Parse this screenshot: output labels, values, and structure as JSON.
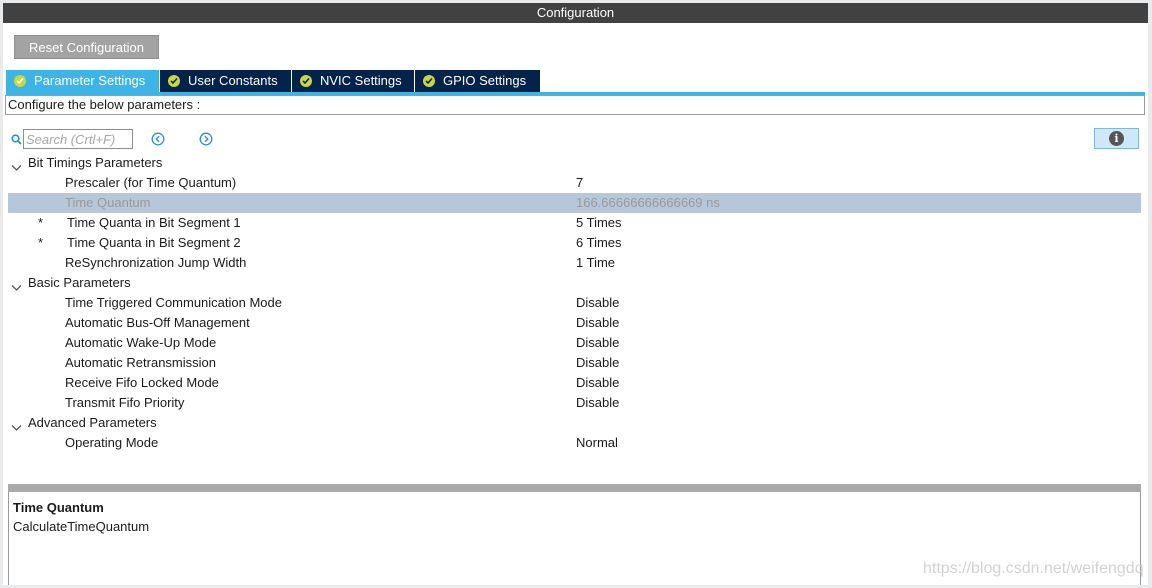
{
  "window": {
    "title": "Configuration"
  },
  "toolbar": {
    "reset_label": "Reset Configuration"
  },
  "tabs": [
    {
      "label": "Parameter Settings",
      "active": true
    },
    {
      "label": "User Constants",
      "active": false
    },
    {
      "label": "NVIC Settings",
      "active": false
    },
    {
      "label": "GPIO Settings",
      "active": false
    }
  ],
  "configure_prompt": "Configure the below parameters :",
  "search": {
    "placeholder": "Search (Crtl+F)"
  },
  "groups": {
    "bit_timings": {
      "label": "Bit Timings Parameters",
      "rows": [
        {
          "label": "Prescaler (for Time Quantum)",
          "value": "7"
        },
        {
          "label": "Time Quantum",
          "value": "166.66666666666669 ns",
          "selected": true
        },
        {
          "label": "Time Quanta in Bit Segment 1",
          "value": "5 Times",
          "starred": true
        },
        {
          "label": "Time Quanta in Bit Segment 2",
          "value": "6 Times",
          "starred": true
        },
        {
          "label": "ReSynchronization Jump Width",
          "value": "1 Time"
        }
      ]
    },
    "basic": {
      "label": "Basic Parameters",
      "rows": [
        {
          "label": "Time Triggered Communication Mode",
          "value": "Disable"
        },
        {
          "label": "Automatic Bus-Off Management",
          "value": "Disable"
        },
        {
          "label": "Automatic Wake-Up Mode",
          "value": "Disable"
        },
        {
          "label": "Automatic Retransmission",
          "value": "Disable"
        },
        {
          "label": "Receive Fifo Locked Mode",
          "value": "Disable"
        },
        {
          "label": "Transmit Fifo Priority",
          "value": "Disable"
        }
      ]
    },
    "advanced": {
      "label": "Advanced Parameters",
      "rows": [
        {
          "label": "Operating Mode",
          "value": "Normal"
        }
      ]
    }
  },
  "star_marker": "*",
  "description": {
    "title": "Time Quantum",
    "text": "CalculateTimeQuantum"
  },
  "watermark": "https://blog.csdn.net/weifengdq",
  "info_glyph": "i",
  "colors": {
    "tab_active": "#3cb4e6",
    "tab_inactive": "#03234b",
    "check": "#c9d93b",
    "selected_row": "#b6c7da"
  }
}
